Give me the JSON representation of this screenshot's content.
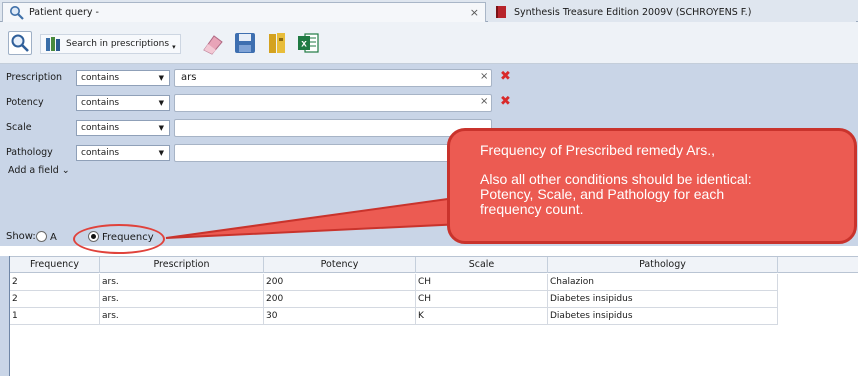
{
  "tabs": {
    "active_title": "Patient query -",
    "active_close": "×",
    "inactive_title": "Synthesis Treasure Edition 2009V (SCHROYENS F.)"
  },
  "toolbar": {
    "search_prescriptions_label": "Search in prescriptions",
    "excel_label": "x"
  },
  "query": {
    "rows": [
      {
        "field": "Prescription",
        "operator": "contains",
        "value": "ars"
      },
      {
        "field": "Potency",
        "operator": "contains",
        "value": ""
      },
      {
        "field": "Scale",
        "operator": "contains",
        "value": ""
      },
      {
        "field": "Pathology",
        "operator": "contains",
        "value": ""
      }
    ],
    "clear_glyph": "×",
    "remove_glyph": "✖",
    "dropdown_glyph": "▼",
    "add_field_label": "Add a field",
    "add_field_caret": "⌄"
  },
  "show": {
    "label": "Show:",
    "option_all": "A",
    "option_frequency": "Frequency",
    "selected": "Frequency"
  },
  "table": {
    "columns": [
      "Frequency",
      "Prescription",
      "Potency",
      "Scale",
      "Pathology"
    ],
    "rows": [
      [
        "2",
        "ars.",
        "200",
        "CH",
        "Chalazion"
      ],
      [
        "2",
        "ars.",
        "200",
        "CH",
        "Diabetes insipidus"
      ],
      [
        "1",
        "ars.",
        "30",
        "K",
        "Diabetes insipidus"
      ]
    ]
  },
  "callout": {
    "line1": "Frequency of Prescribed remedy Ars.,",
    "line2": "Also all other conditions should be identical:",
    "line3": "Potency, Scale, and Pathology for each",
    "line4": "frequency count."
  },
  "colors": {
    "query_panel": "#c9d5e7",
    "callout_fill": "#ec5b52",
    "remove_red": "#d92a2a"
  }
}
